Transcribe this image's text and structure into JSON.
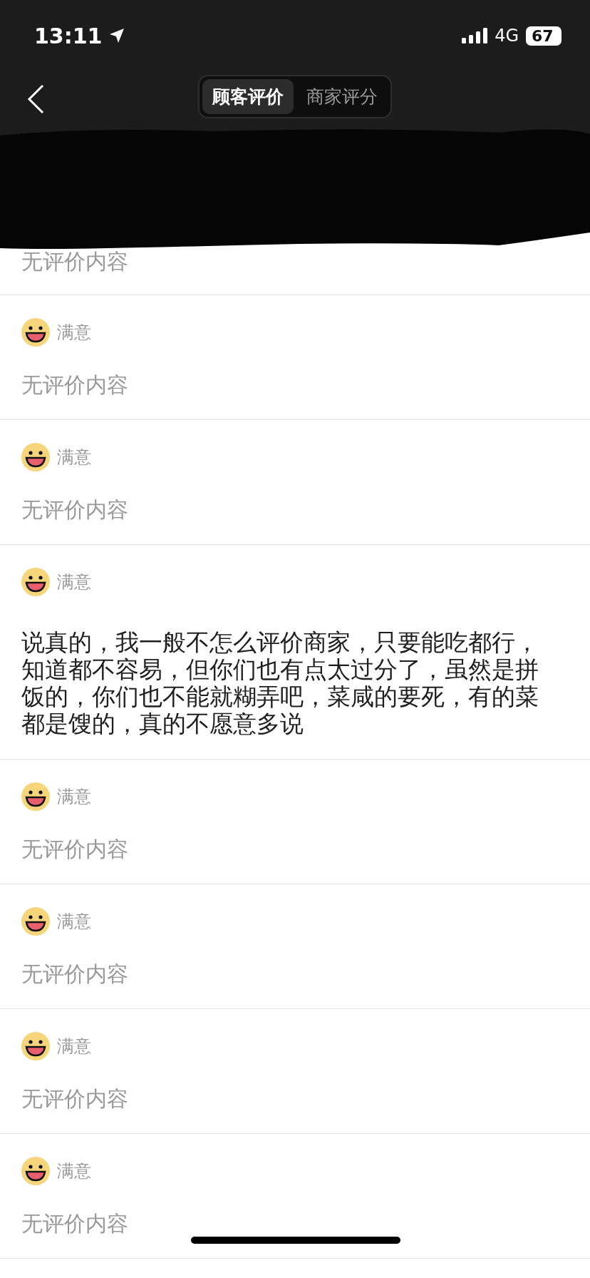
{
  "status_bar": {
    "time": "13:11",
    "network": "4G",
    "battery": "67"
  },
  "nav": {
    "tabs": [
      {
        "label": "顾客评价",
        "selected": true
      },
      {
        "label": "商家评分",
        "selected": false
      }
    ]
  },
  "partial_review": {
    "comment": "无评价内容"
  },
  "reviews": [
    {
      "rating": "满意",
      "kind": "empty",
      "comment": "无评价内容"
    },
    {
      "rating": "满意",
      "kind": "empty",
      "comment": "无评价内容"
    },
    {
      "rating": "满意",
      "kind": "text",
      "comment": "说真的，我一般不怎么评价商家，只要能吃都行，知道都不容易，但你们也有点太过分了，虽然是拼饭的，你们也不能就糊弄吧，菜咸的要死，有的菜都是馊的，真的不愿意多说"
    },
    {
      "rating": "满意",
      "kind": "empty",
      "comment": "无评价内容"
    },
    {
      "rating": "满意",
      "kind": "empty",
      "comment": "无评价内容"
    },
    {
      "rating": "满意",
      "kind": "empty",
      "comment": "无评价内容"
    },
    {
      "rating": "满意",
      "kind": "empty",
      "comment": "无评价内容"
    }
  ]
}
